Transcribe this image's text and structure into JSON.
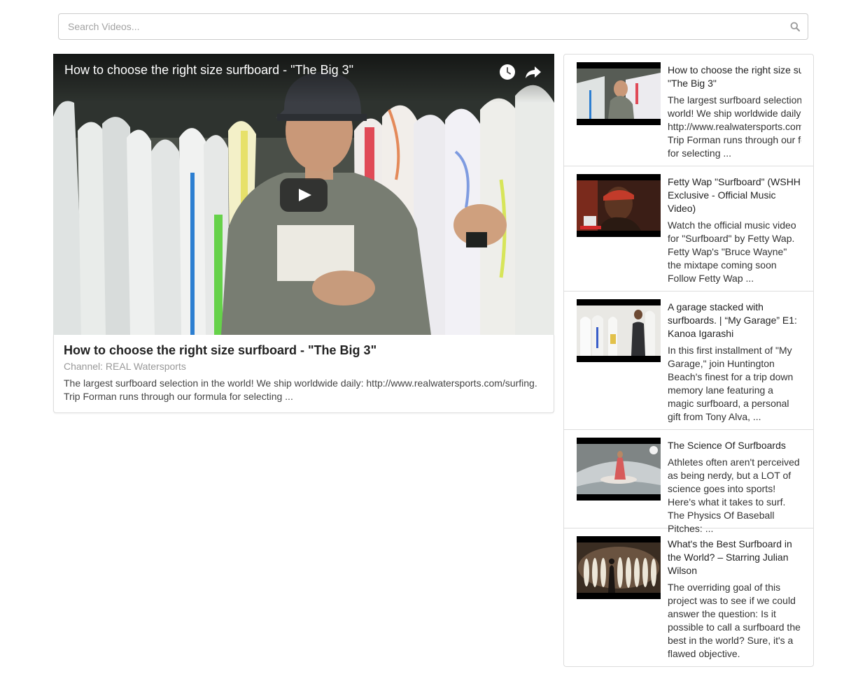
{
  "search": {
    "placeholder": "Search Videos..."
  },
  "player": {
    "overlay_title": "How to choose the right size surfboard - \"The Big 3\"",
    "title": "How to choose the right size surfboard - \"The Big 3\"",
    "channel": "Channel: REAL Watersports",
    "description": "The largest surfboard selection in the world! We ship worldwide daily: http://www.realwatersports.com/surfing. Trip Forman runs through our formula for selecting ..."
  },
  "videos": [
    {
      "title_lines": [
        "How to choose the right size surfboard -",
        "\"The Big 3\""
      ],
      "desc_lines": [
        "The largest surfboard selection in the",
        "world! We ship worldwide daily:",
        "http://www.realwatersports.com/surfing.",
        "Trip Forman runs through our formula",
        "for selecting ..."
      ]
    },
    {
      "title": "Fetty Wap \"Surfboard\" (WSHH Exclusive - Official Music Video)",
      "description": "Watch the official music video for \"Surfboard\" by Fetty Wap. Fetty Wap's \"Bruce Wayne\" the mixtape coming soon Follow Fetty Wap ..."
    },
    {
      "title": "A garage stacked with surfboards. | “My Garage” E1: Kanoa Igarashi",
      "description": "In this first installment of \"My Garage,\" join Huntington Beach's finest for a trip down memory lane featuring a magic surfboard, a personal gift from Tony Alva, ..."
    },
    {
      "title": "The Science Of Surfboards",
      "description": "Athletes often aren't perceived as being nerdy, but a LOT of science goes into sports! Here's what it takes to surf. The Physics Of Baseball Pitches: ..."
    },
    {
      "title": "What's the Best Surfboard in the World? – Starring Julian Wilson",
      "description": "The overriding goal of this project was to see if we could answer the question: Is it possible to call a surfboard the best in the world? Sure, it's a flawed objective."
    }
  ]
}
